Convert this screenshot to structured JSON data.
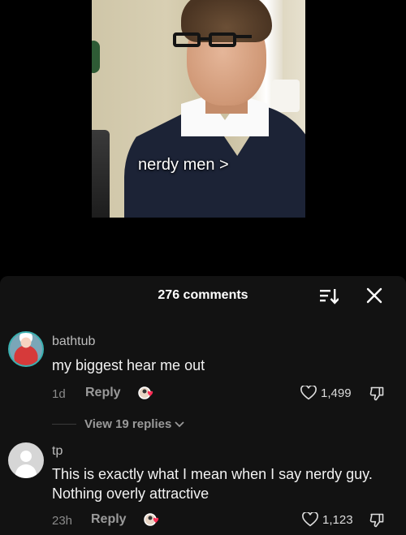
{
  "video": {
    "caption": "nerdy men >"
  },
  "comments_panel": {
    "title": "276 comments",
    "sort_icon": "sort-icon",
    "close_icon": "close-icon"
  },
  "comments": [
    {
      "username": "bathtub",
      "text": "my biggest hear me out",
      "time": "1d",
      "reply_label": "Reply",
      "likes": "1,499",
      "view_replies": "View 19 replies"
    },
    {
      "username": "tp",
      "text": "This is exactly what I mean when I say nerdy guy. Nothing overly attractive",
      "time": "23h",
      "reply_label": "Reply",
      "likes": "1,123"
    }
  ],
  "colors": {
    "panel_bg": "#121212",
    "avatar_ring": "#3ab0b0",
    "muted_text": "#9a9a9a"
  }
}
